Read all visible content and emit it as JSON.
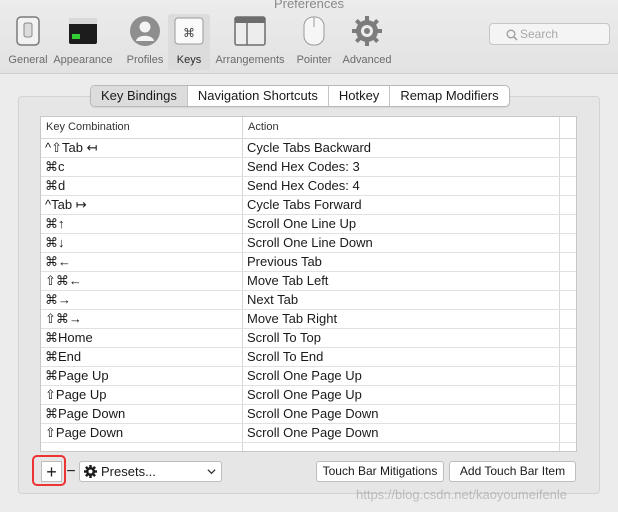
{
  "window": {
    "title": "Preferences"
  },
  "toolbar": {
    "items": [
      {
        "label": "General",
        "icon": "general-switch-icon"
      },
      {
        "label": "Appearance",
        "icon": "appearance-window-icon"
      },
      {
        "label": "Profiles",
        "icon": "profiles-user-icon"
      },
      {
        "label": "Keys",
        "icon": "keys-command-icon",
        "selected": true
      },
      {
        "label": "Arrangements",
        "icon": "arrangements-windows-icon"
      },
      {
        "label": "Pointer",
        "icon": "pointer-mouse-icon"
      },
      {
        "label": "Advanced",
        "icon": "advanced-gear-icon"
      }
    ],
    "search_placeholder": "Search"
  },
  "tabs": [
    {
      "label": "Key Bindings",
      "active": true
    },
    {
      "label": "Navigation Shortcuts"
    },
    {
      "label": "Hotkey"
    },
    {
      "label": "Remap Modifiers"
    }
  ],
  "table": {
    "headers": {
      "key": "Key Combination",
      "action": "Action"
    },
    "rows": [
      {
        "key": "^⇧Tab ↤",
        "action": "Cycle Tabs Backward"
      },
      {
        "key": "⌘c",
        "action": "Send Hex Codes: 3"
      },
      {
        "key": "⌘d",
        "action": "Send Hex Codes: 4"
      },
      {
        "key": "^Tab ↦",
        "action": "Cycle Tabs Forward"
      },
      {
        "key": "⌘↑",
        "action": "Scroll One Line Up"
      },
      {
        "key": "⌘↓",
        "action": "Scroll One Line Down"
      },
      {
        "key": "⌘←",
        "action": "Previous Tab"
      },
      {
        "key": "⇧⌘←",
        "action": "Move Tab Left"
      },
      {
        "key": "⌘→",
        "action": "Next Tab"
      },
      {
        "key": "⇧⌘→",
        "action": "Move Tab Right"
      },
      {
        "key": "⌘Home",
        "action": "Scroll To Top"
      },
      {
        "key": "⌘End",
        "action": "Scroll To End"
      },
      {
        "key": "⌘Page Up",
        "action": "Scroll One Page Up"
      },
      {
        "key": "⇧Page Up",
        "action": "Scroll One Page Up"
      },
      {
        "key": "⌘Page Down",
        "action": "Scroll One Page Down"
      },
      {
        "key": "⇧Page Down",
        "action": "Scroll One Page Down"
      }
    ]
  },
  "controls": {
    "add": "+",
    "remove": "−",
    "presets": "Presets...",
    "touch_bar_mitigations": "Touch Bar Mitigations",
    "add_touch_bar_item": "Add Touch Bar Item"
  },
  "watermark": "https://blog.csdn.net/kaoyoumeifenle",
  "colors": {
    "highlight": "#e33333"
  }
}
